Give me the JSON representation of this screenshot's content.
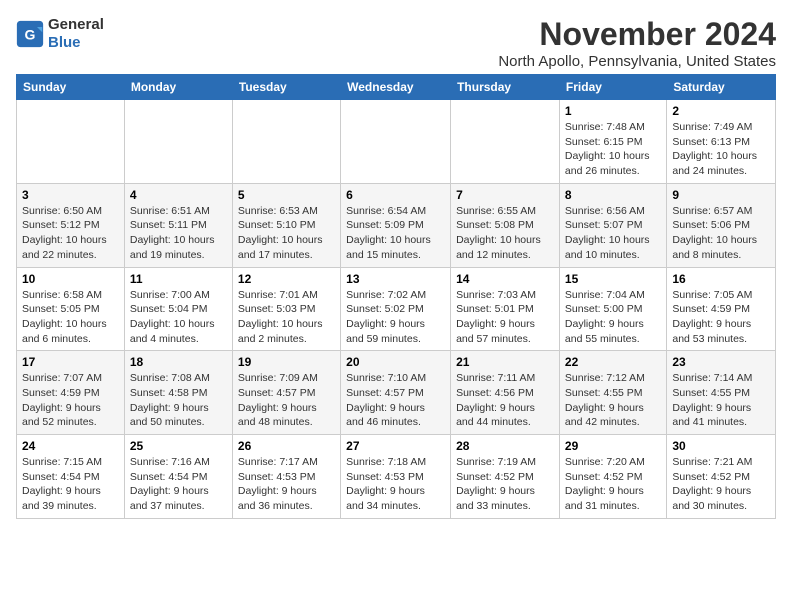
{
  "logo": {
    "line1": "General",
    "line2": "Blue"
  },
  "title": "November 2024",
  "location": "North Apollo, Pennsylvania, United States",
  "days_of_week": [
    "Sunday",
    "Monday",
    "Tuesday",
    "Wednesday",
    "Thursday",
    "Friday",
    "Saturday"
  ],
  "weeks": [
    [
      {
        "day": "",
        "info": ""
      },
      {
        "day": "",
        "info": ""
      },
      {
        "day": "",
        "info": ""
      },
      {
        "day": "",
        "info": ""
      },
      {
        "day": "",
        "info": ""
      },
      {
        "day": "1",
        "info": "Sunrise: 7:48 AM\nSunset: 6:15 PM\nDaylight: 10 hours and 26 minutes."
      },
      {
        "day": "2",
        "info": "Sunrise: 7:49 AM\nSunset: 6:13 PM\nDaylight: 10 hours and 24 minutes."
      }
    ],
    [
      {
        "day": "3",
        "info": "Sunrise: 6:50 AM\nSunset: 5:12 PM\nDaylight: 10 hours and 22 minutes."
      },
      {
        "day": "4",
        "info": "Sunrise: 6:51 AM\nSunset: 5:11 PM\nDaylight: 10 hours and 19 minutes."
      },
      {
        "day": "5",
        "info": "Sunrise: 6:53 AM\nSunset: 5:10 PM\nDaylight: 10 hours and 17 minutes."
      },
      {
        "day": "6",
        "info": "Sunrise: 6:54 AM\nSunset: 5:09 PM\nDaylight: 10 hours and 15 minutes."
      },
      {
        "day": "7",
        "info": "Sunrise: 6:55 AM\nSunset: 5:08 PM\nDaylight: 10 hours and 12 minutes."
      },
      {
        "day": "8",
        "info": "Sunrise: 6:56 AM\nSunset: 5:07 PM\nDaylight: 10 hours and 10 minutes."
      },
      {
        "day": "9",
        "info": "Sunrise: 6:57 AM\nSunset: 5:06 PM\nDaylight: 10 hours and 8 minutes."
      }
    ],
    [
      {
        "day": "10",
        "info": "Sunrise: 6:58 AM\nSunset: 5:05 PM\nDaylight: 10 hours and 6 minutes."
      },
      {
        "day": "11",
        "info": "Sunrise: 7:00 AM\nSunset: 5:04 PM\nDaylight: 10 hours and 4 minutes."
      },
      {
        "day": "12",
        "info": "Sunrise: 7:01 AM\nSunset: 5:03 PM\nDaylight: 10 hours and 2 minutes."
      },
      {
        "day": "13",
        "info": "Sunrise: 7:02 AM\nSunset: 5:02 PM\nDaylight: 9 hours and 59 minutes."
      },
      {
        "day": "14",
        "info": "Sunrise: 7:03 AM\nSunset: 5:01 PM\nDaylight: 9 hours and 57 minutes."
      },
      {
        "day": "15",
        "info": "Sunrise: 7:04 AM\nSunset: 5:00 PM\nDaylight: 9 hours and 55 minutes."
      },
      {
        "day": "16",
        "info": "Sunrise: 7:05 AM\nSunset: 4:59 PM\nDaylight: 9 hours and 53 minutes."
      }
    ],
    [
      {
        "day": "17",
        "info": "Sunrise: 7:07 AM\nSunset: 4:59 PM\nDaylight: 9 hours and 52 minutes."
      },
      {
        "day": "18",
        "info": "Sunrise: 7:08 AM\nSunset: 4:58 PM\nDaylight: 9 hours and 50 minutes."
      },
      {
        "day": "19",
        "info": "Sunrise: 7:09 AM\nSunset: 4:57 PM\nDaylight: 9 hours and 48 minutes."
      },
      {
        "day": "20",
        "info": "Sunrise: 7:10 AM\nSunset: 4:57 PM\nDaylight: 9 hours and 46 minutes."
      },
      {
        "day": "21",
        "info": "Sunrise: 7:11 AM\nSunset: 4:56 PM\nDaylight: 9 hours and 44 minutes."
      },
      {
        "day": "22",
        "info": "Sunrise: 7:12 AM\nSunset: 4:55 PM\nDaylight: 9 hours and 42 minutes."
      },
      {
        "day": "23",
        "info": "Sunrise: 7:14 AM\nSunset: 4:55 PM\nDaylight: 9 hours and 41 minutes."
      }
    ],
    [
      {
        "day": "24",
        "info": "Sunrise: 7:15 AM\nSunset: 4:54 PM\nDaylight: 9 hours and 39 minutes."
      },
      {
        "day": "25",
        "info": "Sunrise: 7:16 AM\nSunset: 4:54 PM\nDaylight: 9 hours and 37 minutes."
      },
      {
        "day": "26",
        "info": "Sunrise: 7:17 AM\nSunset: 4:53 PM\nDaylight: 9 hours and 36 minutes."
      },
      {
        "day": "27",
        "info": "Sunrise: 7:18 AM\nSunset: 4:53 PM\nDaylight: 9 hours and 34 minutes."
      },
      {
        "day": "28",
        "info": "Sunrise: 7:19 AM\nSunset: 4:52 PM\nDaylight: 9 hours and 33 minutes."
      },
      {
        "day": "29",
        "info": "Sunrise: 7:20 AM\nSunset: 4:52 PM\nDaylight: 9 hours and 31 minutes."
      },
      {
        "day": "30",
        "info": "Sunrise: 7:21 AM\nSunset: 4:52 PM\nDaylight: 9 hours and 30 minutes."
      }
    ]
  ]
}
